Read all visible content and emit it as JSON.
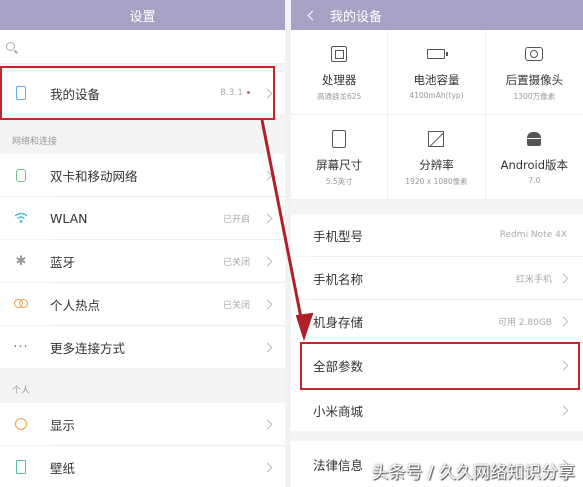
{
  "left": {
    "title": "设置",
    "my_device": {
      "label": "我的设备",
      "value": "8.3.1"
    },
    "section_network": "网络和连接",
    "network_items": [
      {
        "label": "双卡和移动网络",
        "value": ""
      },
      {
        "label": "WLAN",
        "value": "已开启"
      },
      {
        "label": "蓝牙",
        "value": "已关闭"
      },
      {
        "label": "个人热点",
        "value": "已关闭"
      },
      {
        "label": "更多连接方式",
        "value": ""
      }
    ],
    "section_personal": "个人",
    "personal_items": [
      {
        "label": "显示"
      },
      {
        "label": "壁纸"
      }
    ]
  },
  "right": {
    "title": "我的设备",
    "specs": [
      {
        "title": "处理器",
        "sub": "高通骁龙625",
        "icon": "chip-icon"
      },
      {
        "title": "电池容量",
        "sub": "4100mAh(typ)",
        "icon": "battery-icon"
      },
      {
        "title": "后置摄像头",
        "sub": "1300万像素",
        "icon": "camera-icon"
      },
      {
        "title": "屏幕尺寸",
        "sub": "5.5英寸",
        "icon": "screen-icon"
      },
      {
        "title": "分辨率",
        "sub": "1920 x 1080像素",
        "icon": "resolution-icon"
      },
      {
        "title": "Android版本",
        "sub": "7.0",
        "icon": "android-icon"
      }
    ],
    "rows": [
      {
        "label": "手机型号",
        "value": "Redmi Note 4X"
      },
      {
        "label": "手机名称",
        "value": "红米手机"
      },
      {
        "label": "机身存储",
        "value": "可用 2.80GB"
      },
      {
        "label": "全部参数",
        "value": ""
      },
      {
        "label": "小米商城",
        "value": ""
      },
      {
        "label": "法律信息",
        "value": ""
      }
    ]
  },
  "watermark": "头条号 / 久久网络知识分享",
  "colors": {
    "header": "#a9a1c4",
    "highlight": "#c1272d"
  }
}
